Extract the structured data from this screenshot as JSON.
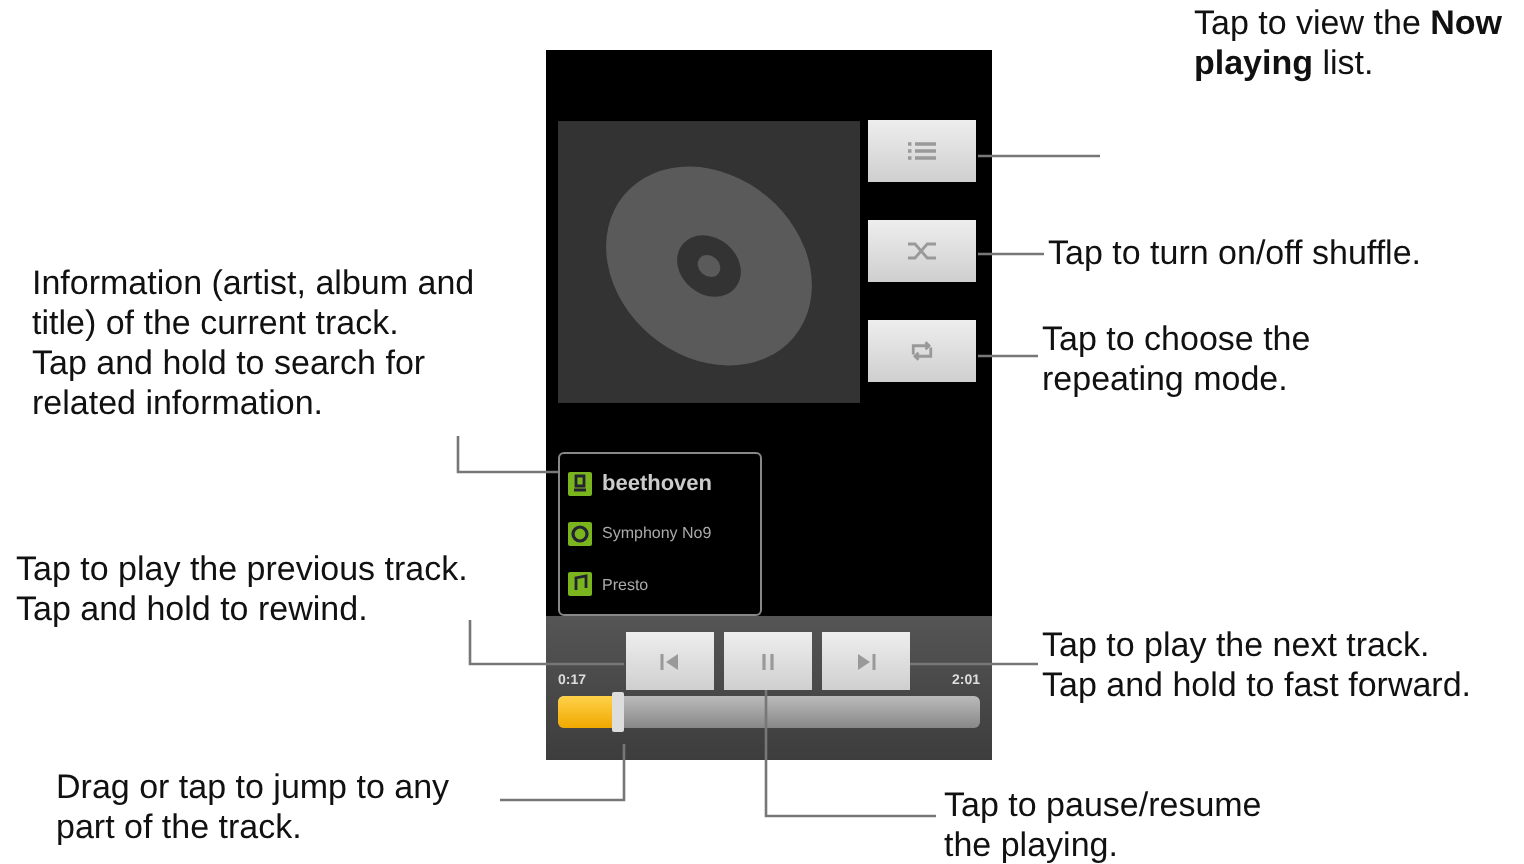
{
  "player": {
    "side_buttons": [
      {
        "kind": "list"
      },
      {
        "kind": "shuffle"
      },
      {
        "kind": "repeat"
      }
    ],
    "track_info": [
      {
        "kind": "artist",
        "text": "beethoven"
      },
      {
        "kind": "album",
        "text": "Symphony No9"
      },
      {
        "kind": "title",
        "text": "Presto"
      }
    ],
    "controls": [
      {
        "kind": "previous"
      },
      {
        "kind": "pause"
      },
      {
        "kind": "next"
      }
    ],
    "elapsed": "0:17",
    "duration": "2:01",
    "progress": {
      "level": 0.14
    }
  },
  "callouts": [
    {
      "text": "Tap to view the **Now**\n**playing** list."
    },
    {
      "text": "Tap to turn on/off shuffle."
    },
    {
      "text": "Information (artist, album and\ntitle) of the current track.\nTap and hold to search for\nrelated information."
    },
    {
      "text": "Tap to choose the\nrepeating mode."
    },
    {
      "text": "Tap to play the previous track.\nTap and hold to rewind."
    },
    {
      "text": "Tap to play the next track.\nTap and hold to fast forward."
    },
    {
      "text": "Drag or tap to jump to any\npart of the track."
    },
    {
      "text": "Tap to pause/resume\nthe playing."
    }
  ]
}
